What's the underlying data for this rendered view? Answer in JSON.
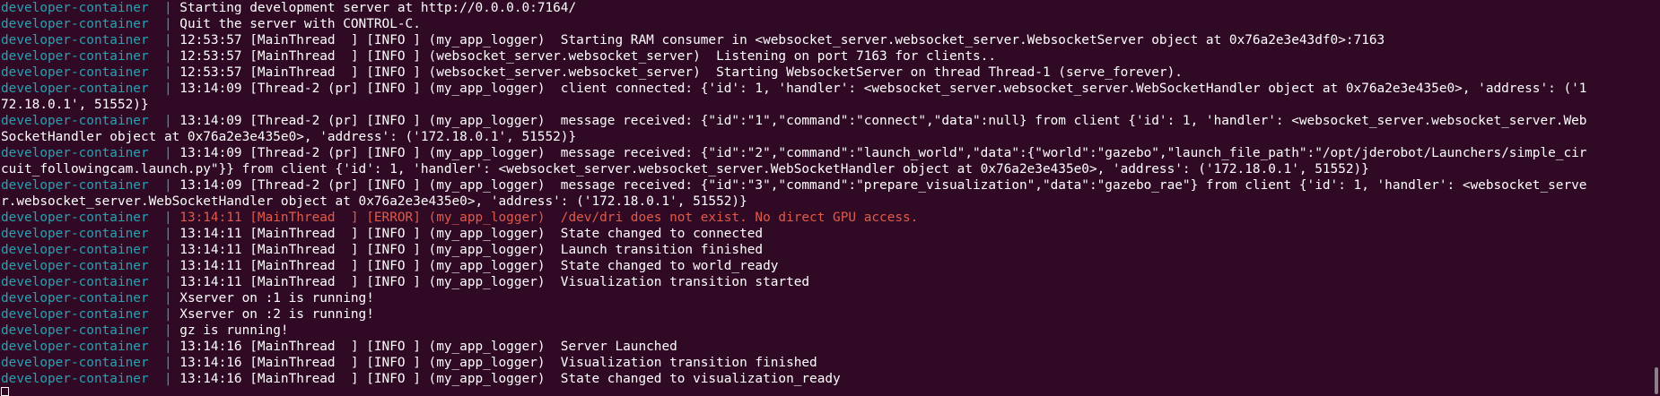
{
  "terminal": {
    "prefix": "developer-container  | ",
    "cont_prefix": "",
    "colors": {
      "background": "#300a24",
      "text": "#ffffff",
      "prefix": "#2aa1b3",
      "error": "#e05a4a"
    },
    "lines": [
      {
        "p": true,
        "t": "Starting development server at http://0.0.0.0:7164/"
      },
      {
        "p": true,
        "t": "Quit the server with CONTROL-C."
      },
      {
        "p": true,
        "t": "12:53:57 [MainThread  ] [INFO ] (my_app_logger)  Starting RAM consumer in <websocket_server.websocket_server.WebsocketServer object at 0x76a2e3e43df0>:7163"
      },
      {
        "p": true,
        "t": "12:53:57 [MainThread  ] [INFO ] (websocket_server.websocket_server)  Listening on port 7163 for clients.."
      },
      {
        "p": true,
        "t": "12:53:57 [MainThread  ] [INFO ] (websocket_server.websocket_server)  Starting WebsocketServer on thread Thread-1 (serve_forever)."
      },
      {
        "p": true,
        "t": "13:14:09 [Thread-2 (pr] [INFO ] (my_app_logger)  client connected: {'id': 1, 'handler': <websocket_server.websocket_server.WebSocketHandler object at 0x76a2e3e435e0>, 'address': ('1"
      },
      {
        "p": false,
        "t": "72.18.0.1', 51552)}"
      },
      {
        "p": true,
        "t": "13:14:09 [Thread-2 (pr] [INFO ] (my_app_logger)  message received: {\"id\":\"1\",\"command\":\"connect\",\"data\":null} from client {'id': 1, 'handler': <websocket_server.websocket_server.Web"
      },
      {
        "p": false,
        "t": "SocketHandler object at 0x76a2e3e435e0>, 'address': ('172.18.0.1', 51552)}"
      },
      {
        "p": true,
        "t": "13:14:09 [Thread-2 (pr] [INFO ] (my_app_logger)  message received: {\"id\":\"2\",\"command\":\"launch_world\",\"data\":{\"world\":\"gazebo\",\"launch_file_path\":\"/opt/jderobot/Launchers/simple_cir"
      },
      {
        "p": false,
        "t": "cuit_followingcam.launch.py\"}} from client {'id': 1, 'handler': <websocket_server.websocket_server.WebSocketHandler object at 0x76a2e3e435e0>, 'address': ('172.18.0.1', 51552)}"
      },
      {
        "p": true,
        "t": "13:14:09 [Thread-2 (pr] [INFO ] (my_app_logger)  message received: {\"id\":\"3\",\"command\":\"prepare_visualization\",\"data\":\"gazebo_rae\"} from client {'id': 1, 'handler': <websocket_serve"
      },
      {
        "p": false,
        "t": "r.websocket_server.WebSocketHandler object at 0x76a2e3e435e0>, 'address': ('172.18.0.1', 51552)}"
      },
      {
        "p": true,
        "t": "13:14:11 [MainThread  ] [ERROR] (my_app_logger)  /dev/dri does not exist. No direct GPU access.",
        "err": true
      },
      {
        "p": true,
        "t": "13:14:11 [MainThread  ] [INFO ] (my_app_logger)  State changed to connected"
      },
      {
        "p": true,
        "t": "13:14:11 [MainThread  ] [INFO ] (my_app_logger)  Launch transition finished"
      },
      {
        "p": true,
        "t": "13:14:11 [MainThread  ] [INFO ] (my_app_logger)  State changed to world_ready"
      },
      {
        "p": true,
        "t": "13:14:11 [MainThread  ] [INFO ] (my_app_logger)  Visualization transition started"
      },
      {
        "p": true,
        "t": "Xserver on :1 is running!"
      },
      {
        "p": true,
        "t": "Xserver on :2 is running!"
      },
      {
        "p": true,
        "t": "gz is running!"
      },
      {
        "p": true,
        "t": "13:14:16 [MainThread  ] [INFO ] (my_app_logger)  Server Launched"
      },
      {
        "p": true,
        "t": "13:14:16 [MainThread  ] [INFO ] (my_app_logger)  Visualization transition finished"
      },
      {
        "p": true,
        "t": "13:14:16 [MainThread  ] [INFO ] (my_app_logger)  State changed to visualization_ready"
      }
    ]
  }
}
